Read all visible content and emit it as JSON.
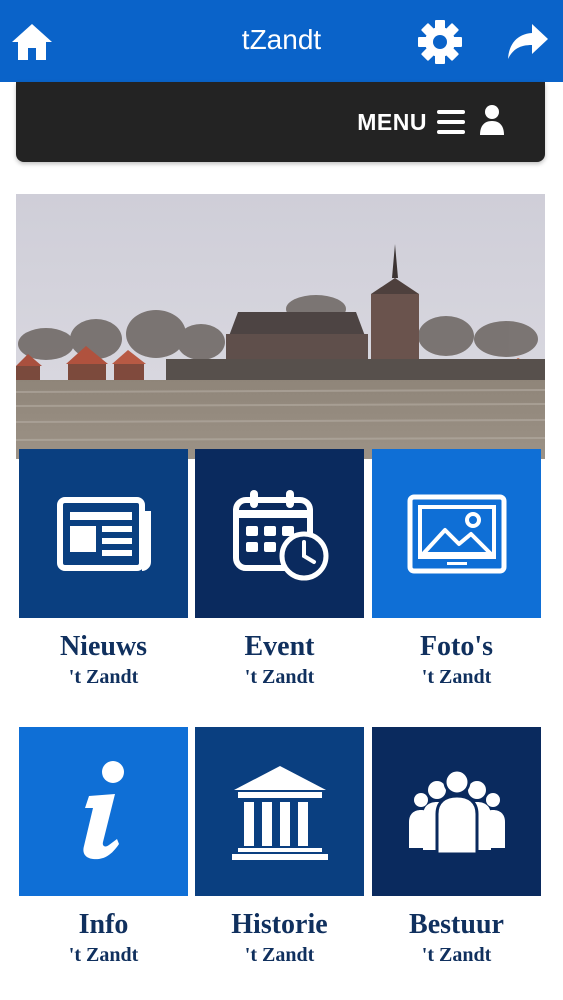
{
  "app_title": "tZandt",
  "header": {
    "home_icon": "home-icon",
    "settings_icon": "gear-icon",
    "share_icon": "share-icon"
  },
  "menu": {
    "label": "MENU",
    "hamburger_icon": "hamburger-icon",
    "user_icon": "user-icon"
  },
  "colors": {
    "primary_blue": "#0a63c9",
    "navy_tile": "#0a3f80",
    "dark_navy_tile": "#0a2a5e",
    "bright_tile": "#0f6fd6",
    "menu_bar": "#232323",
    "label_text": "#10305e"
  },
  "tiles": [
    {
      "title": "Nieuws",
      "subtitle": "'t Zandt",
      "icon": "newspaper-icon"
    },
    {
      "title": "Event",
      "subtitle": "'t Zandt",
      "icon": "calendar-clock-icon"
    },
    {
      "title": "Foto's",
      "subtitle": "'t Zandt",
      "icon": "photo-icon"
    },
    {
      "title": "Info",
      "subtitle": "'t Zandt",
      "icon": "info-icon"
    },
    {
      "title": "Historie",
      "subtitle": "'t Zandt",
      "icon": "museum-icon"
    },
    {
      "title": "Bestuur",
      "subtitle": "'t Zandt",
      "icon": "people-icon"
    }
  ]
}
